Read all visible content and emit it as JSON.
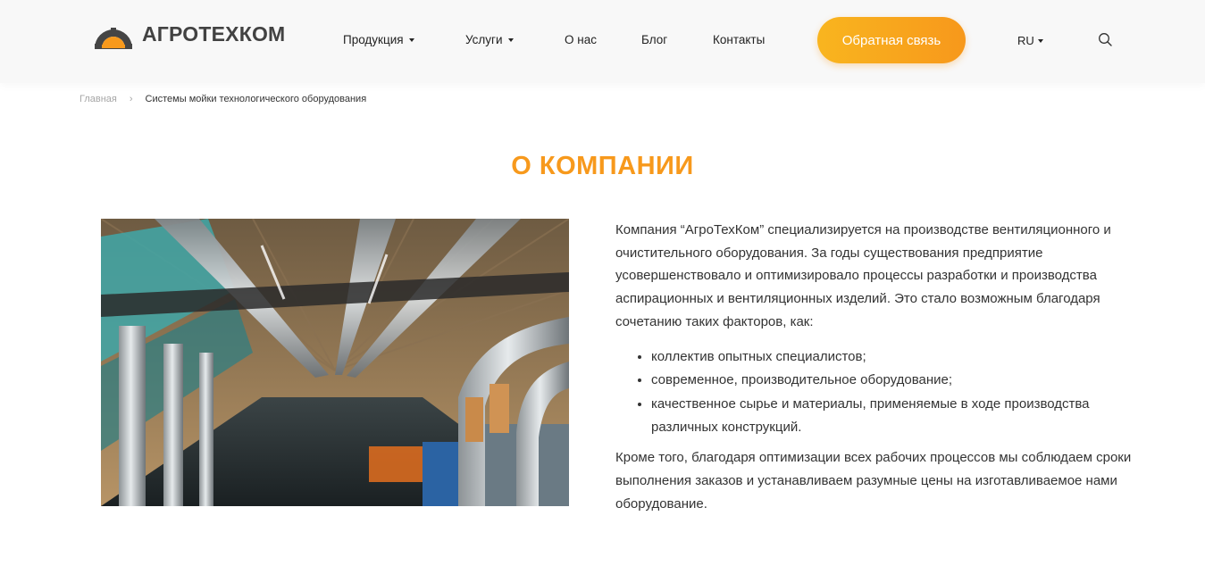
{
  "header": {
    "logo_text": "АГРОТЕХКОМ",
    "nav": [
      {
        "label": "Продукция",
        "has_dropdown": true
      },
      {
        "label": "Услуги",
        "has_dropdown": true
      },
      {
        "label": "О нас",
        "has_dropdown": false
      },
      {
        "label": "Блог",
        "has_dropdown": false
      },
      {
        "label": "Контакты",
        "has_dropdown": false
      }
    ],
    "cta_label": "Обратная связь",
    "lang": "RU",
    "search_icon": "search-icon"
  },
  "breadcrumb": {
    "home": "Главная",
    "separator": "›",
    "current": "Системы мойки технологического оборудования"
  },
  "section": {
    "title": "О КОМПАНИИ",
    "intro": "Компания “АгроТехКом” специализируется на производстве вентиляционного и очистительного оборудования. За годы существования предприятие усовершенствовало и оптимизировало процессы разработки и производства аспирационных и вентиляционных изделий. Это стало возможным благодаря сочетанию таких факторов, как:",
    "factors": [
      "коллектив опытных специалистов;",
      "современное, производительное оборудование;",
      "качественное сырье и материалы, применяемые в ходе производства различных конструкций."
    ],
    "outro": "Кроме того, благодаря оптимизации всех рабочих процессов мы соблюдаем сроки выполнения заказов и устанавливаем разумные цены на изготавливаемое нами оборудование."
  },
  "colors": {
    "accent": "#f7991c",
    "cta_start": "#f9b51f",
    "cta_end": "#f7981b",
    "logo_gray": "#454545"
  }
}
